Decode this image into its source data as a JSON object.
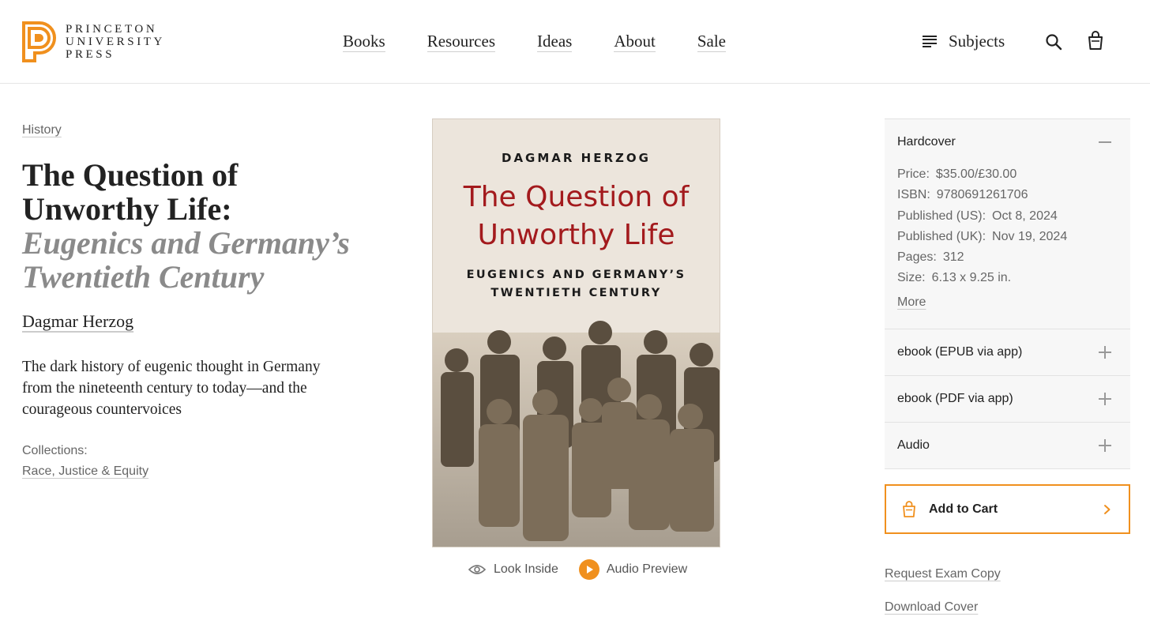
{
  "header": {
    "logo_lines": [
      "PRINCETON",
      "UNIVERSITY",
      "PRESS"
    ],
    "nav": [
      "Books",
      "Resources",
      "Ideas",
      "About",
      "Sale"
    ],
    "subjects_label": "Subjects",
    "icons": {
      "menu": "menu-lines-icon",
      "search": "search-icon",
      "bag": "shopping-bag-icon"
    },
    "brand_color": "#f0901e"
  },
  "book": {
    "breadcrumb": "History",
    "title_main": "The Question of Unworthy Life:",
    "title_sub": "Eugenics and Germany’s Twentieth Century",
    "author": "Dagmar Herzog",
    "blurb": "The dark history of eugenic thought in Germany from the nineteenth century to today—and the courageous countervoices",
    "collections_label": "Collections:",
    "collections_link": "Race, Justice & Equity"
  },
  "cover": {
    "author": "DAGMAR HERZOG",
    "title_line1": "The Question of",
    "title_line2": "Unworthy Life",
    "subtitle_line1": "EUGENICS AND GERMANY’S",
    "subtitle_line2": "TWENTIETH CENTURY",
    "title_color": "#a31a1d",
    "background": "#ece5dc",
    "look_inside": "Look Inside",
    "audio_preview": "Audio Preview"
  },
  "formats": {
    "open": {
      "name": "Hardcover",
      "details": [
        {
          "label": "Price:",
          "value": "$35.00/£30.00"
        },
        {
          "label": "ISBN:",
          "value": "9780691261706"
        },
        {
          "label": "Published (US):",
          "value": "Oct 8, 2024"
        },
        {
          "label": "Published (UK):",
          "value": "Nov 19, 2024"
        },
        {
          "label": "Pages:",
          "value": "312"
        },
        {
          "label": "Size:",
          "value": "6.13 x 9.25 in."
        }
      ],
      "more": "More"
    },
    "closed": [
      "ebook (EPUB via app)",
      "ebook (PDF via app)",
      "Audio"
    ]
  },
  "actions": {
    "add_to_cart": "Add to Cart",
    "request_exam": "Request Exam Copy",
    "download_cover": "Download Cover"
  }
}
